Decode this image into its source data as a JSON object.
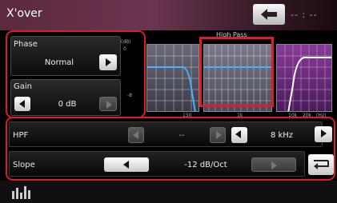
{
  "window": {
    "title": "X'over",
    "status_text": "-- : --"
  },
  "phase": {
    "label": "Phase",
    "value": "Normal"
  },
  "gain": {
    "label": "Gain",
    "value": "0 dB"
  },
  "graph": {
    "band_label": "High Pass",
    "y_label_top": "(dB)",
    "y_label_mid": "0",
    "y_label_low": "-8",
    "x_ticks": [
      "150",
      "1k",
      "10k",
      "20k",
      "(Hz)"
    ]
  },
  "hpf": {
    "label": "HPF",
    "off_value": "--",
    "freq_value": "8 kHz"
  },
  "slope": {
    "label": "Slope",
    "value": "-12 dB/Oct"
  },
  "colors": {
    "highlight": "#d81e2a",
    "title_bar": "#6a3550",
    "curve": "#4ab0ff"
  },
  "icons": [
    "back-arrow-icon",
    "left-arrow-icon",
    "right-arrow-icon",
    "return-icon",
    "equalizer-icon"
  ]
}
